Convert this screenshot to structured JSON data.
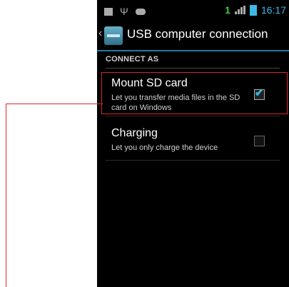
{
  "status_bar": {
    "time": "16:17",
    "notification_count": "1",
    "icons": [
      "screenshot-icon",
      "usb-icon",
      "android-icon",
      "network-signal-icon",
      "battery-icon"
    ]
  },
  "action_bar": {
    "title": "USB computer connection",
    "icon": "usb-settings-icon"
  },
  "category": {
    "header": "CONNECT AS"
  },
  "prefs": [
    {
      "title": "Mount SD card",
      "summary": "Let you transfer media files in the SD card on Windows",
      "checked": true
    },
    {
      "title": "Charging",
      "summary": "Let you only charge the device",
      "checked": false
    }
  ],
  "colors": {
    "accent": "#3fb8e6",
    "callout": "#d9232d",
    "background": "#000000"
  }
}
